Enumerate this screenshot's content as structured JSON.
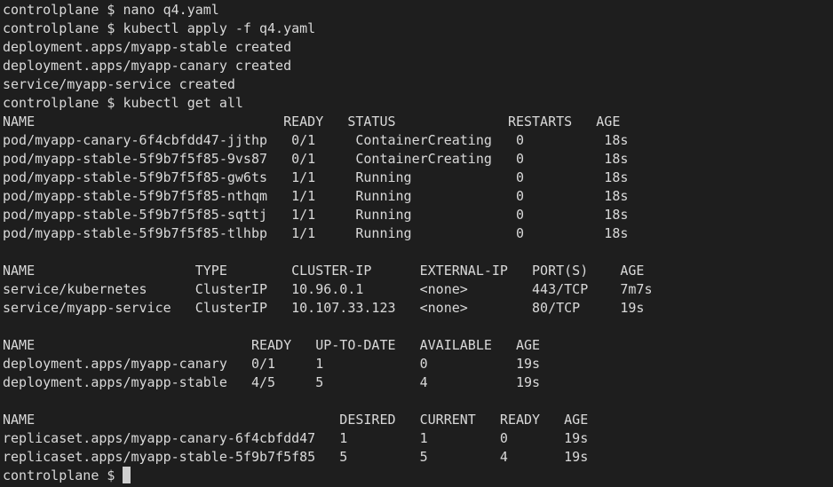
{
  "terminal": {
    "lines": [
      "controlplane $ nano q4.yaml",
      "controlplane $ kubectl apply -f q4.yaml",
      "deployment.apps/myapp-stable created",
      "deployment.apps/myapp-canary created",
      "service/myapp-service created",
      "controlplane $ kubectl get all",
      "NAME                               READY   STATUS              RESTARTS   AGE",
      "pod/myapp-canary-6f4cbfdd47-jjthp   0/1     ContainerCreating   0          18s",
      "pod/myapp-stable-5f9b7f5f85-9vs87   0/1     ContainerCreating   0          18s",
      "pod/myapp-stable-5f9b7f5f85-gw6ts   1/1     Running             0          18s",
      "pod/myapp-stable-5f9b7f5f85-nthqm   1/1     Running             0          18s",
      "pod/myapp-stable-5f9b7f5f85-sqttj   1/1     Running             0          18s",
      "pod/myapp-stable-5f9b7f5f85-tlhbp   1/1     Running             0          18s",
      "",
      "NAME                    TYPE        CLUSTER-IP      EXTERNAL-IP   PORT(S)    AGE",
      "service/kubernetes      ClusterIP   10.96.0.1       <none>        443/TCP    7m7s",
      "service/myapp-service   ClusterIP   10.107.33.123   <none>        80/TCP     19s",
      "",
      "NAME                           READY   UP-TO-DATE   AVAILABLE   AGE",
      "deployment.apps/myapp-canary   0/1     1            0           19s",
      "deployment.apps/myapp-stable   4/5     5            4           19s",
      "",
      "NAME                                      DESIRED   CURRENT   READY   AGE",
      "replicaset.apps/myapp-canary-6f4cbfdd47   1         1         0       19s",
      "replicaset.apps/myapp-stable-5f9b7f5f85   5         5         4       19s"
    ],
    "prompt": "controlplane $ "
  },
  "colors": {
    "background": "#1e1e1e",
    "foreground": "#d9d9d9",
    "cursor": "#cfcfcf"
  }
}
